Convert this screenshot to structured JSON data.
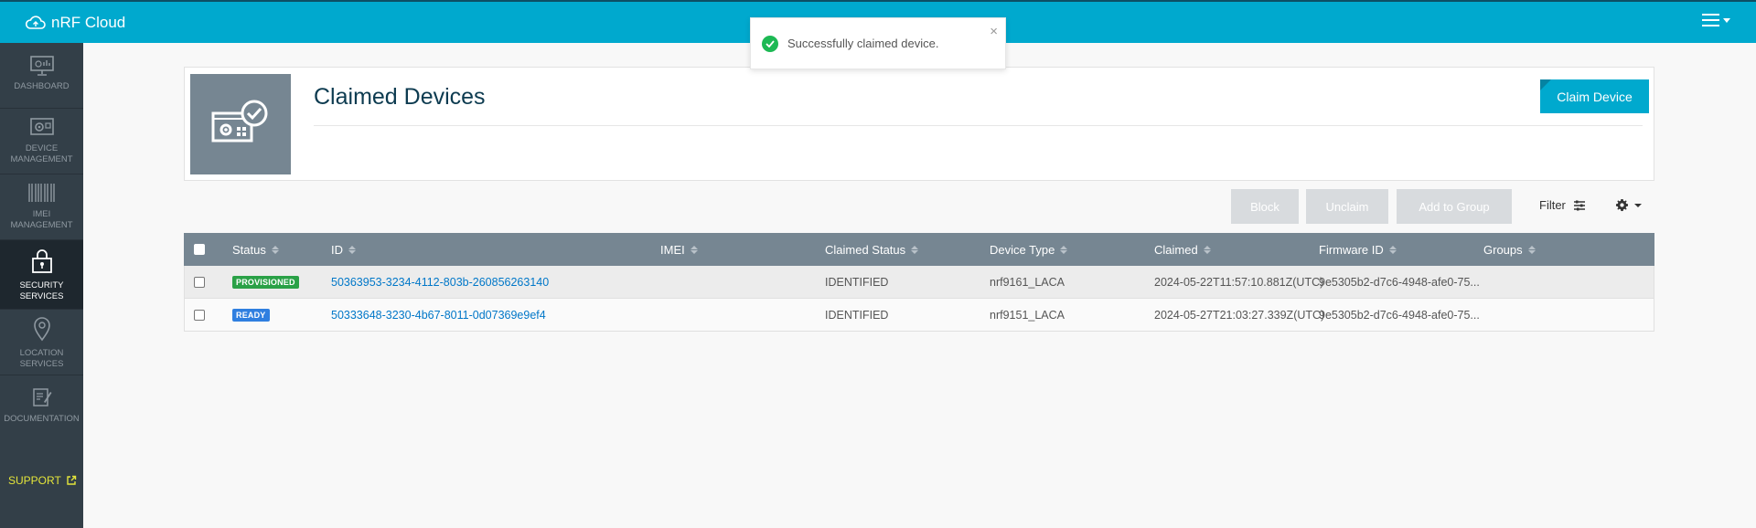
{
  "app": {
    "title": "nRF Cloud"
  },
  "sidebar": {
    "items": [
      {
        "label": "DASHBOARD",
        "icon": "monitor-icon"
      },
      {
        "label": "DEVICE MANAGEMENT",
        "icon": "device-gear-icon"
      },
      {
        "label": "IMEI MANAGEMENT",
        "icon": "barcode-icon"
      },
      {
        "label": "SECURITY SERVICES",
        "icon": "lock-icon",
        "active": true
      },
      {
        "label": "LOCATION SERVICES",
        "icon": "map-pin-icon"
      },
      {
        "label": "DOCUMENTATION",
        "icon": "document-edit-icon"
      }
    ],
    "support": "SUPPORT"
  },
  "page": {
    "title": "Claimed Devices",
    "claim_button": "Claim Device"
  },
  "toolbar": {
    "block": "Block",
    "unclaim": "Unclaim",
    "add_to_group": "Add to Group",
    "filter": "Filter"
  },
  "table": {
    "columns": [
      "Status",
      "ID",
      "IMEI",
      "Claimed Status",
      "Device Type",
      "Claimed",
      "Firmware ID",
      "Groups"
    ],
    "rows": [
      {
        "status": "PROVISIONED",
        "id": "50363953-3234-4112-803b-260856263140",
        "imei": "",
        "claimed_status": "IDENTIFIED",
        "device_type": "nrf9161_LACA",
        "claimed": "2024-05-22T11:57:10.881Z(UTC)",
        "firmware_id": "9e5305b2-d7c6-4948-afe0-75...",
        "groups": ""
      },
      {
        "status": "READY",
        "id": "50333648-3230-4b67-8011-0d07369e9ef4",
        "imei": "",
        "claimed_status": "IDENTIFIED",
        "device_type": "nrf9151_LACA",
        "claimed": "2024-05-27T21:03:27.339Z(UTC)",
        "firmware_id": "9e5305b2-d7c6-4948-afe0-75...",
        "groups": ""
      }
    ]
  },
  "toast": {
    "message": "Successfully claimed device.",
    "close": "×"
  },
  "colors": {
    "brand": "#00a9ce",
    "sidebar": "#333f48",
    "table_header": "#768692",
    "provisioned": "#2aa147",
    "ready": "#2f7fe0",
    "support": "#e4e53a"
  }
}
